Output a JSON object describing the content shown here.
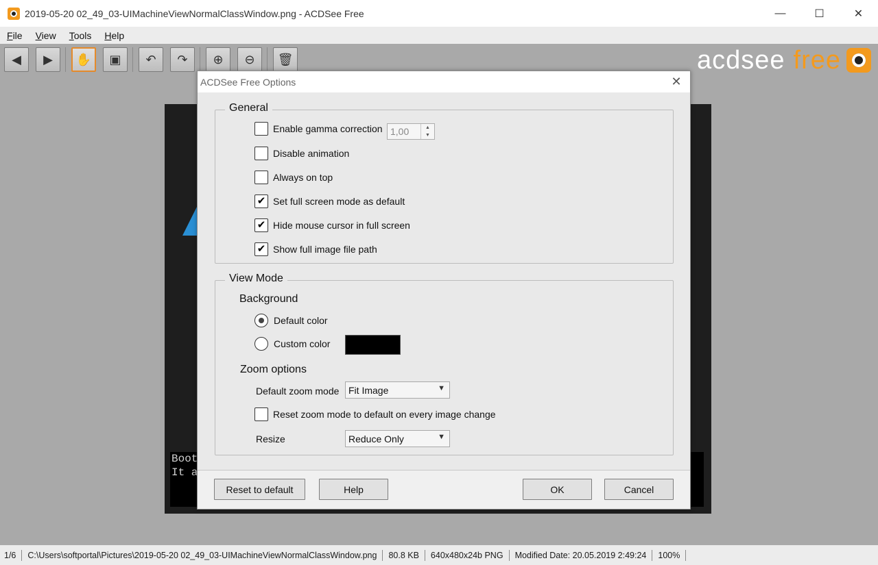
{
  "window": {
    "title": "2019-05-20 02_49_03-UIMachineViewNormalClassWindow.png - ACDSee Free",
    "minimize": "—",
    "maximize": "☐",
    "close": "✕"
  },
  "menu": [
    {
      "mnemonic": "F",
      "rest": "ile"
    },
    {
      "mnemonic": "V",
      "rest": "iew"
    },
    {
      "mnemonic": "T",
      "rest": "ools"
    },
    {
      "mnemonic": "H",
      "rest": "elp"
    }
  ],
  "toolbar": {
    "prev": "◀",
    "next": "▶",
    "hand": "✋",
    "fit": "▣",
    "rotate_left": "↶",
    "rotate_right": "↷",
    "zoom_in": "⊕",
    "zoom_out": "⊖",
    "delete": "🗑"
  },
  "brand": {
    "word1": "acdsee",
    "word2": "free"
  },
  "viewer": {
    "console_line1": "Boot",
    "console_line2": "It a"
  },
  "dialog": {
    "title": "ACDSee Free Options",
    "close": "✕",
    "general": {
      "legend": "General",
      "gamma_label": "Enable gamma correction",
      "gamma_value": "1,00",
      "options": [
        {
          "label": "Enable gamma correction",
          "checked": false
        },
        {
          "label": "Disable animation",
          "checked": false
        },
        {
          "label": "Always on top",
          "checked": false
        },
        {
          "label": "Set full screen mode as default",
          "checked": true
        },
        {
          "label": "Hide mouse cursor in full screen",
          "checked": true
        },
        {
          "label": "Show full image file path",
          "checked": true
        }
      ]
    },
    "view_mode": {
      "legend": "View Mode",
      "background_heading": "Background",
      "default_color": "Default color",
      "custom_color": "Custom color",
      "background_selected": "default",
      "custom_color_swatch": "#000000",
      "zoom_heading": "Zoom options",
      "default_zoom_label": "Default zoom mode",
      "default_zoom_value": "Fit Image",
      "reset_zoom_label": "Reset zoom mode to default on every image change",
      "reset_zoom_checked": false,
      "resize_label": "Resize",
      "resize_value": "Reduce Only"
    },
    "buttons": {
      "reset": "Reset to default",
      "help": "Help",
      "ok": "OK",
      "cancel": "Cancel"
    }
  },
  "status": {
    "index": "1/6",
    "path": "C:\\Users\\softportal\\Pictures\\2019-05-20 02_49_03-UIMachineViewNormalClassWindow.png",
    "size": "80.8 KB",
    "dimensions": "640x480x24b PNG",
    "modified": "Modified Date: 20.05.2019 2:49:24",
    "zoom": "100%"
  },
  "colors": {
    "accent": "#f39a1e",
    "viewer_bg": "#a9a9a9",
    "dialog_bg": "#f0f0f0"
  }
}
